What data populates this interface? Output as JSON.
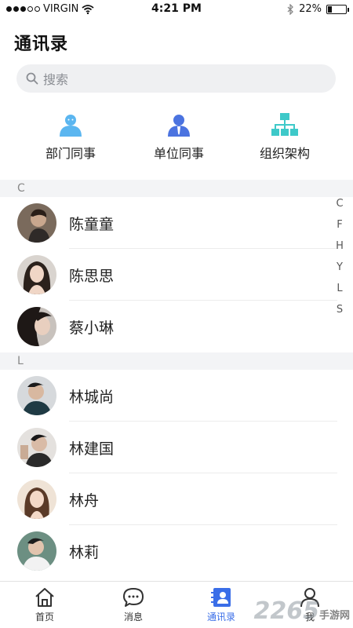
{
  "status_bar": {
    "carrier": "VIRGIN",
    "time": "4:21 PM",
    "battery": "22%",
    "battery_level": 0.22
  },
  "page_title": "通讯录",
  "search": {
    "placeholder": "搜索"
  },
  "quick_entries": [
    {
      "label": "部门同事",
      "icon": "department-colleagues-icon"
    },
    {
      "label": "单位同事",
      "icon": "unit-colleagues-icon"
    },
    {
      "label": "组织架构",
      "icon": "org-chart-icon"
    }
  ],
  "sections": [
    {
      "letter": "C",
      "contacts": [
        {
          "name": "陈童童"
        },
        {
          "name": "陈思思"
        },
        {
          "name": "蔡小琳"
        }
      ]
    },
    {
      "letter": "L",
      "contacts": [
        {
          "name": "林城尚"
        },
        {
          "name": "林建国"
        },
        {
          "name": "林舟"
        },
        {
          "name": "林莉"
        }
      ]
    }
  ],
  "alphabet_index": [
    "C",
    "F",
    "H",
    "Y",
    "L",
    "S"
  ],
  "tab_bar": {
    "tabs": [
      {
        "label": "首页",
        "icon": "home-icon"
      },
      {
        "label": "消息",
        "icon": "message-icon"
      },
      {
        "label": "通讯录",
        "icon": "contacts-icon",
        "active": true
      },
      {
        "label": "我",
        "icon": "profile-icon"
      }
    ]
  },
  "watermark": {
    "text": "2265",
    "sub": "手游网"
  },
  "colors": {
    "accent": "#3a6ee8",
    "icon_light_blue": "#5bb6f0",
    "icon_blue": "#4b73e0",
    "icon_teal": "#3ec9c9",
    "section_bg": "#f3f4f6",
    "search_bg": "#eff0f2"
  }
}
